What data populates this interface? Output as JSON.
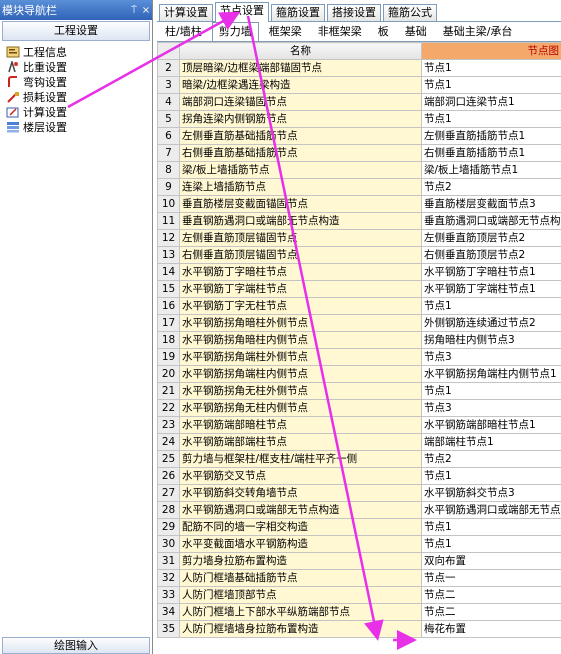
{
  "navigator": {
    "title": "模块导航栏",
    "pin": "ꟷ",
    "close": "×",
    "section": "工程设置",
    "items": [
      {
        "label": "工程信息",
        "icon": "project-info-icon"
      },
      {
        "label": "比重设置",
        "icon": "density-settings-icon"
      },
      {
        "label": "弯钩设置",
        "icon": "hook-settings-icon"
      },
      {
        "label": "损耗设置",
        "icon": "loss-settings-icon"
      },
      {
        "label": "计算设置",
        "icon": "calc-settings-icon"
      },
      {
        "label": "楼层设置",
        "icon": "floor-settings-icon"
      }
    ],
    "bottom": "绘图输入"
  },
  "tabs_top": [
    "计算设置",
    "节点设置",
    "箍筋设置",
    "搭接设置",
    "箍筋公式"
  ],
  "tabs_sub": [
    "柱/墙柱",
    "剪力墙",
    "框架梁",
    "非框架梁",
    "板",
    "基础",
    "基础主梁/承台"
  ],
  "table": {
    "headers": {
      "name": "名称",
      "node": "节点图"
    },
    "rows": [
      [
        "2",
        "顶层暗梁/边框梁端部锚固节点",
        "节点1"
      ],
      [
        "3",
        "暗梁/边框梁遇连梁构造",
        "节点1"
      ],
      [
        "4",
        "端部洞口连梁锚固节点",
        "端部洞口连梁节点1"
      ],
      [
        "5",
        "拐角连梁内侧钢筋节点",
        "节点1"
      ],
      [
        "6",
        "左侧垂直筋基础插筋节点",
        "左侧垂直筋插筋节点1"
      ],
      [
        "7",
        "右侧垂直筋基础插筋节点",
        "右侧垂直筋插筋节点1"
      ],
      [
        "8",
        "梁/板上墙插筋节点",
        "梁/板上墙插筋节点1"
      ],
      [
        "9",
        "连梁上墙插筋节点",
        "节点2"
      ],
      [
        "10",
        "垂直筋楼层变截面锚固节点",
        "垂直筋楼层变截面节点3"
      ],
      [
        "11",
        "垂直钢筋遇洞口或端部无节点构造",
        "垂直筋遇洞口或端部无节点构"
      ],
      [
        "12",
        "左侧垂直筋顶层锚固节点",
        "左侧垂直筋顶层节点2"
      ],
      [
        "13",
        "右侧垂直筋顶层锚固节点",
        "右侧垂直筋顶层节点2"
      ],
      [
        "14",
        "水平钢筋丁字暗柱节点",
        "水平钢筋丁字暗柱节点1"
      ],
      [
        "15",
        "水平钢筋丁字端柱节点",
        "水平钢筋丁字端柱节点1"
      ],
      [
        "16",
        "水平钢筋丁字无柱节点",
        "节点1"
      ],
      [
        "17",
        "水平钢筋拐角暗柱外侧节点",
        "外侧钢筋连续通过节点2"
      ],
      [
        "18",
        "水平钢筋拐角暗柱内侧节点",
        "拐角暗柱内侧节点3"
      ],
      [
        "19",
        "水平钢筋拐角端柱外侧节点",
        "节点3"
      ],
      [
        "20",
        "水平钢筋拐角端柱内侧节点",
        "水平钢筋拐角端柱内侧节点1"
      ],
      [
        "21",
        "水平钢筋拐角无柱外侧节点",
        "节点1"
      ],
      [
        "22",
        "水平钢筋拐角无柱内侧节点",
        "节点3"
      ],
      [
        "23",
        "水平钢筋端部暗柱节点",
        "水平钢筋端部暗柱节点1"
      ],
      [
        "24",
        "水平钢筋端部端柱节点",
        "端部端柱节点1"
      ],
      [
        "25",
        "剪力墙与框架柱/框支柱/端柱平齐一侧",
        "节点2"
      ],
      [
        "26",
        "水平钢筋交叉节点",
        "节点1"
      ],
      [
        "27",
        "水平钢筋斜交转角墙节点",
        "水平钢筋斜交节点3"
      ],
      [
        "28",
        "水平钢筋遇洞口或端部无节点构造",
        "水平钢筋遇洞口或端部无节点"
      ],
      [
        "29",
        "配筋不同的墙一字相交构造",
        "节点1"
      ],
      [
        "30",
        "水平变截面墙水平钢筋构造",
        "节点1"
      ],
      [
        "31",
        "剪力墙身拉筋布置构造",
        "双向布置"
      ],
      [
        "32",
        "人防门框墙基础插筋节点",
        "节点一"
      ],
      [
        "33",
        "人防门框墙顶部节点",
        "节点二"
      ],
      [
        "34",
        "人防门框墙上下部水平纵筋端部节点",
        "节点二"
      ],
      [
        "35",
        "人防门框墙墙身拉筋布置构造",
        "梅花布置"
      ]
    ]
  },
  "annotation": {
    "arrow_color": "#e830e8"
  }
}
